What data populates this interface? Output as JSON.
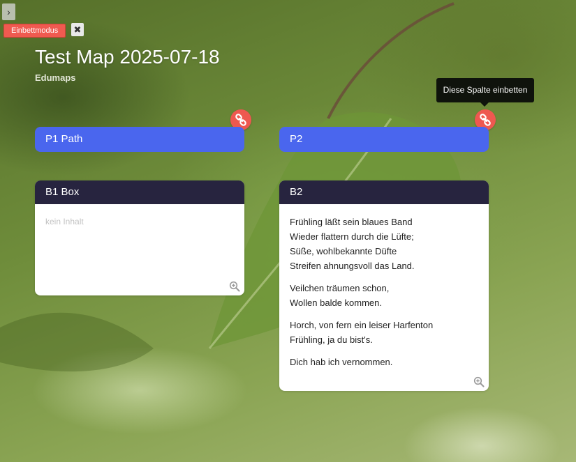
{
  "toolbar": {
    "sidebar_toggle": "›",
    "embed_mode_label": "Einbettmodus",
    "close_symbol": "✖"
  },
  "map": {
    "title": "Test Map 2025-07-18",
    "subtitle": "Edumaps"
  },
  "tooltip": {
    "text": "Diese Spalte einbetten"
  },
  "columns": [
    {
      "path_label": "P1 Path",
      "link_icon": "link-icon",
      "box": {
        "title": "B1 Box",
        "empty_text": "kein Inhalt",
        "zoom_icon": "zoom-in-icon"
      }
    },
    {
      "path_label": "P2",
      "link_icon": "link-icon",
      "box": {
        "title": "B2",
        "paragraphs": [
          [
            "Frühling läßt sein blaues Band",
            "Wieder flattern durch die Lüfte;",
            "Süße, wohlbekannte Düfte",
            "Streifen ahnungsvoll das Land."
          ],
          [
            "Veilchen träumen schon,",
            "Wollen balde kommen."
          ],
          [
            "Horch, von fern ein leiser Harfenton",
            "Frühling, ja du bist's."
          ],
          [
            "Dich hab ich vernommen."
          ]
        ],
        "zoom_icon": "zoom-in-icon"
      }
    }
  ],
  "colors": {
    "path_blue": "#4a66ee",
    "box_header": "#27243f",
    "accent_red": "#ee5850",
    "tooltip_bg": "#0f130c"
  }
}
